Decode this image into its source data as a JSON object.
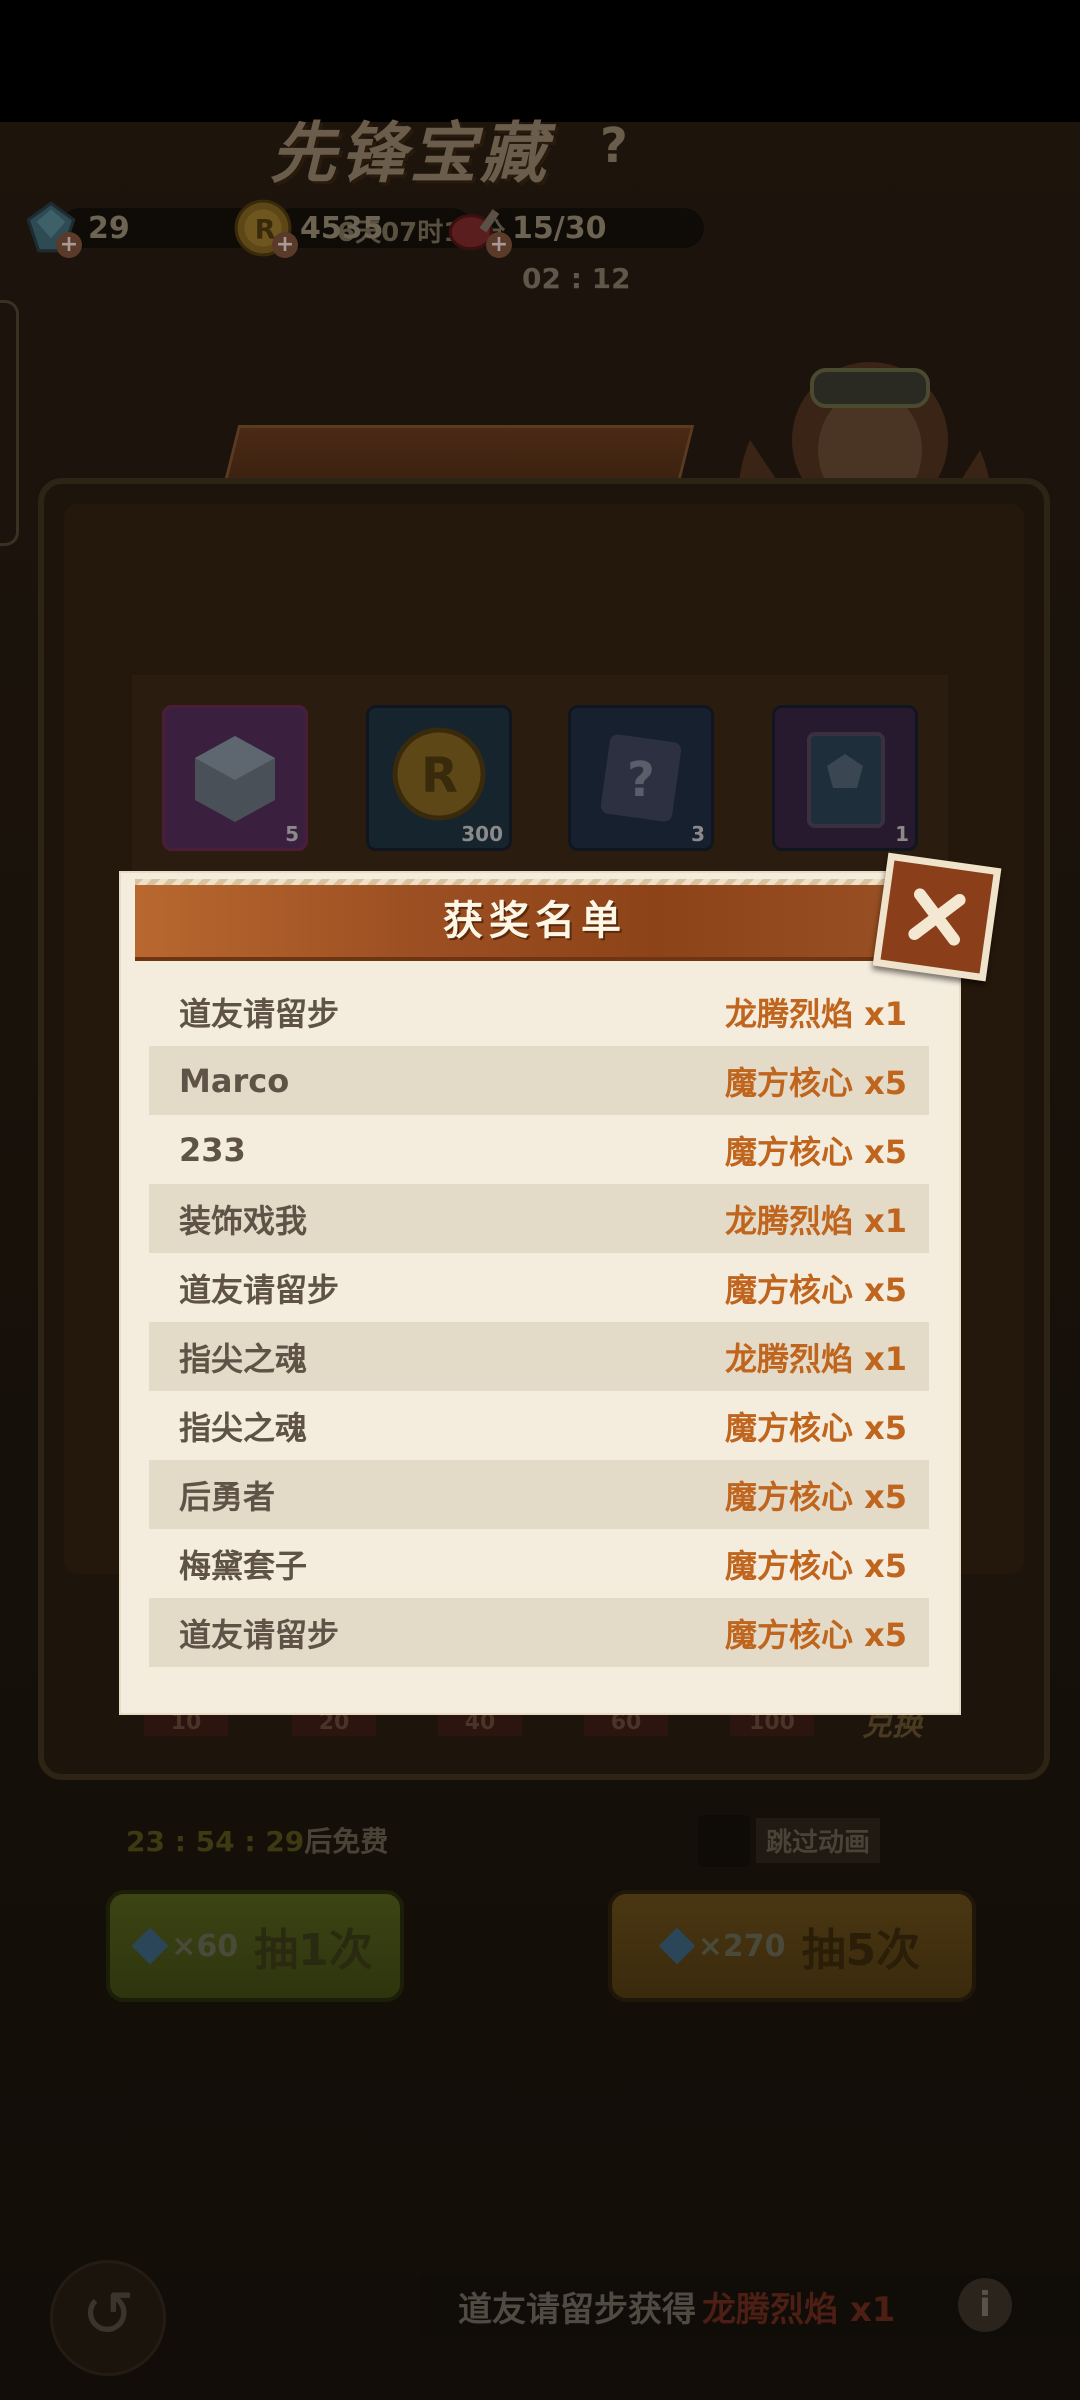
{
  "resources": [
    {
      "name": "diamond",
      "value": "29"
    },
    {
      "name": "coin",
      "value": "4535"
    },
    {
      "name": "stamina",
      "value": "15/30"
    }
  ],
  "stamina_timer": "02 : 12",
  "banner": {
    "title": "先锋宝藏",
    "help": "?",
    "countdown": "6天07时13分"
  },
  "rewards": [
    {
      "icon": "cube-core-icon",
      "count": "5"
    },
    {
      "icon": "r-coin-icon",
      "count": "300"
    },
    {
      "icon": "mystery-box-icon",
      "count": "3"
    },
    {
      "icon": "emblem-book-icon",
      "count": "1"
    }
  ],
  "milestones": [
    "10",
    "20",
    "40",
    "60",
    "100"
  ],
  "exchange_label": "兑换",
  "free": {
    "timer": "23 : 54 : 29",
    "suffix": "后免费"
  },
  "skip_label": "跳过动画",
  "draw_single": {
    "cost": "×60",
    "label": "抽1次"
  },
  "draw_multi": {
    "cost": "×270",
    "label": "抽5次"
  },
  "ticker": {
    "name_text": "道友请留步获得",
    "item_text": "龙腾烈焰 x1"
  },
  "info_label": "i",
  "modal": {
    "title": "获奖名单",
    "winners": [
      {
        "name": "道友请留步",
        "prize": "龙腾烈焰 x1"
      },
      {
        "name": "Marco",
        "prize": "魔方核心 x5"
      },
      {
        "name": "233",
        "prize": "魔方核心 x5"
      },
      {
        "name": "装饰戏我",
        "prize": "龙腾烈焰 x1"
      },
      {
        "name": "道友请留步",
        "prize": "魔方核心 x5"
      },
      {
        "name": "指尖之魂",
        "prize": "龙腾烈焰 x1"
      },
      {
        "name": "指尖之魂",
        "prize": "魔方核心 x5"
      },
      {
        "name": "后勇者",
        "prize": "魔方核心 x5"
      },
      {
        "name": "梅黛套子",
        "prize": "魔方核心 x5"
      },
      {
        "name": "道友请留步",
        "prize": "魔方核心 x5"
      }
    ]
  },
  "colors": {
    "modal_bg": "#f4ecdd",
    "header": "#9c4f22",
    "prize": "#c0651e",
    "name": "#5e5346",
    "alt_row": "#e3dac7"
  }
}
